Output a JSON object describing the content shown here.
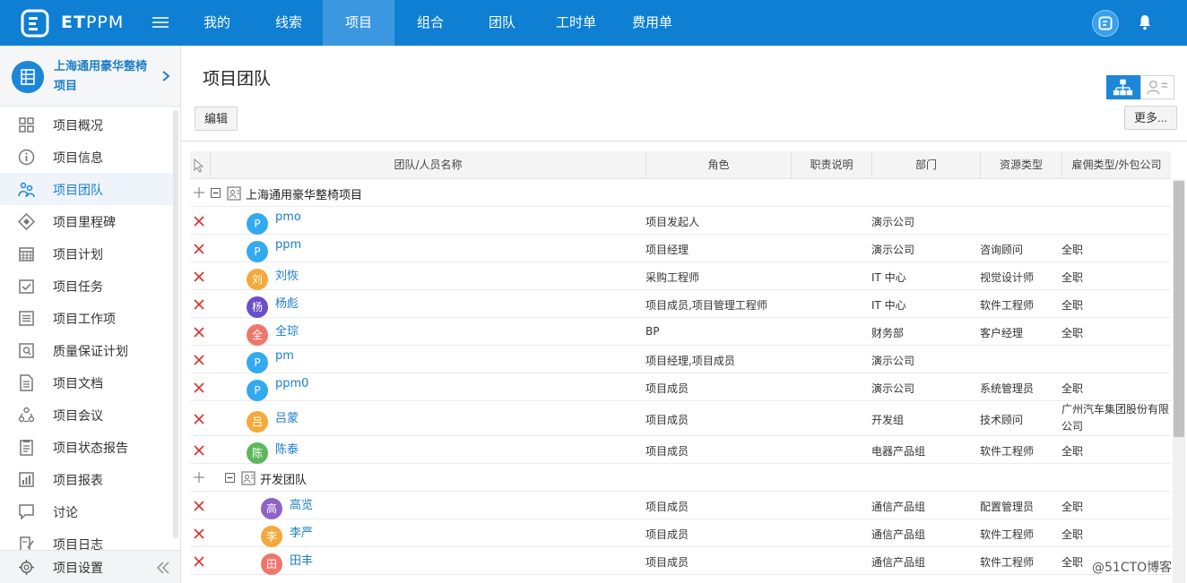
{
  "topbar": {
    "brand_bold": "ET",
    "brand_thin": "PPM",
    "nav": [
      {
        "label": "我的",
        "width": 84
      },
      {
        "label": "线索",
        "width": 76
      },
      {
        "label": "项目",
        "width": 80,
        "active": true
      },
      {
        "label": "组合",
        "width": 80
      },
      {
        "label": "团队",
        "width": 80
      },
      {
        "label": "工时单",
        "width": 85
      },
      {
        "label": "费用单",
        "width": 85
      }
    ]
  },
  "sidebar": {
    "project_name": "上海通用豪华整椅项目",
    "items": [
      {
        "label": "项目概况",
        "icon": "grid-icon"
      },
      {
        "label": "项目信息",
        "icon": "info-icon"
      },
      {
        "label": "项目团队",
        "icon": "team-icon",
        "active": true
      },
      {
        "label": "项目里程碑",
        "icon": "milestone-icon"
      },
      {
        "label": "项目计划",
        "icon": "calendar-icon"
      },
      {
        "label": "项目任务",
        "icon": "task-icon"
      },
      {
        "label": "项目工作项",
        "icon": "list-icon"
      },
      {
        "label": "质量保证计划",
        "icon": "quality-icon"
      },
      {
        "label": "项目文档",
        "icon": "document-icon"
      },
      {
        "label": "项目会议",
        "icon": "meeting-icon"
      },
      {
        "label": "项目状态报告",
        "icon": "report-icon"
      },
      {
        "label": "项目报表",
        "icon": "chart-icon"
      },
      {
        "label": "讨论",
        "icon": "chat-icon"
      },
      {
        "label": "项目日志",
        "icon": "log-icon"
      }
    ],
    "footer_label": "项目设置"
  },
  "main": {
    "title": "项目团队",
    "edit_button": "编辑",
    "more_button": "更多...",
    "columns": [
      "团队/人员名称",
      "角色",
      "职责说明",
      "部门",
      "资源类型",
      "雇佣类型/外包公司"
    ],
    "rows": [
      {
        "type": "group",
        "name": "上海通用豪华整椅项目",
        "level": 0
      },
      {
        "type": "person",
        "avatar": "P",
        "color": "#33aaf0",
        "name": "pmo",
        "role": "项目发起人",
        "dept": "演示公司",
        "resource": "",
        "employ": "",
        "level": 0
      },
      {
        "type": "person",
        "avatar": "P",
        "color": "#33aaf0",
        "name": "ppm",
        "role": "项目经理",
        "dept": "演示公司",
        "resource": "咨询顾问",
        "employ": "全职",
        "level": 0
      },
      {
        "type": "person",
        "avatar": "刘",
        "color": "#f5a93b",
        "name": "刘恢",
        "role": "采购工程师",
        "dept": "IT 中心",
        "resource": "视觉设计师",
        "employ": "全职",
        "level": 0
      },
      {
        "type": "person",
        "avatar": "杨",
        "color": "#6a4fc9",
        "name": "杨彪",
        "role": "项目成员,项目管理工程师",
        "dept": "IT 中心",
        "resource": "软件工程师",
        "employ": "全职",
        "level": 0
      },
      {
        "type": "person",
        "avatar": "全",
        "color": "#f0766c",
        "name": "全琮",
        "role": "BP",
        "dept": "财务部",
        "resource": "客户经理",
        "employ": "全职",
        "level": 0
      },
      {
        "type": "person",
        "avatar": "P",
        "color": "#33aaf0",
        "name": "pm",
        "role": "项目经理,项目成员",
        "dept": "演示公司",
        "resource": "",
        "employ": "",
        "level": 0
      },
      {
        "type": "person",
        "avatar": "P",
        "color": "#33aaf0",
        "name": "ppm0",
        "role": "项目成员",
        "dept": "演示公司",
        "resource": "系统管理员",
        "employ": "全职",
        "level": 0
      },
      {
        "type": "person",
        "avatar": "吕",
        "color": "#f5a93b",
        "name": "吕蒙",
        "role": "项目成员",
        "dept": "开发组",
        "resource": "技术顾问",
        "employ": "广州汽车集团股份有限公司",
        "level": 0,
        "tall": true
      },
      {
        "type": "person",
        "avatar": "陈",
        "color": "#5cb85c",
        "name": "陈泰",
        "role": "项目成员",
        "dept": "电器产品组",
        "resource": "软件工程师",
        "employ": "全职",
        "level": 0
      },
      {
        "type": "group",
        "name": "开发团队",
        "level": 1
      },
      {
        "type": "person",
        "avatar": "高",
        "color": "#8e63c9",
        "name": "高览",
        "role": "项目成员",
        "dept": "通信产品组",
        "resource": "配置管理员",
        "employ": "全职",
        "level": 1
      },
      {
        "type": "person",
        "avatar": "李",
        "color": "#f5a93b",
        "name": "李严",
        "role": "项目成员",
        "dept": "通信产品组",
        "resource": "软件工程师",
        "employ": "全职",
        "level": 1
      },
      {
        "type": "person",
        "avatar": "田",
        "color": "#f0766c",
        "name": "田丰",
        "role": "项目成员",
        "dept": "通信产品组",
        "resource": "软件工程师",
        "employ": "全职",
        "level": 1
      }
    ]
  },
  "watermark": "@51CTO博客"
}
